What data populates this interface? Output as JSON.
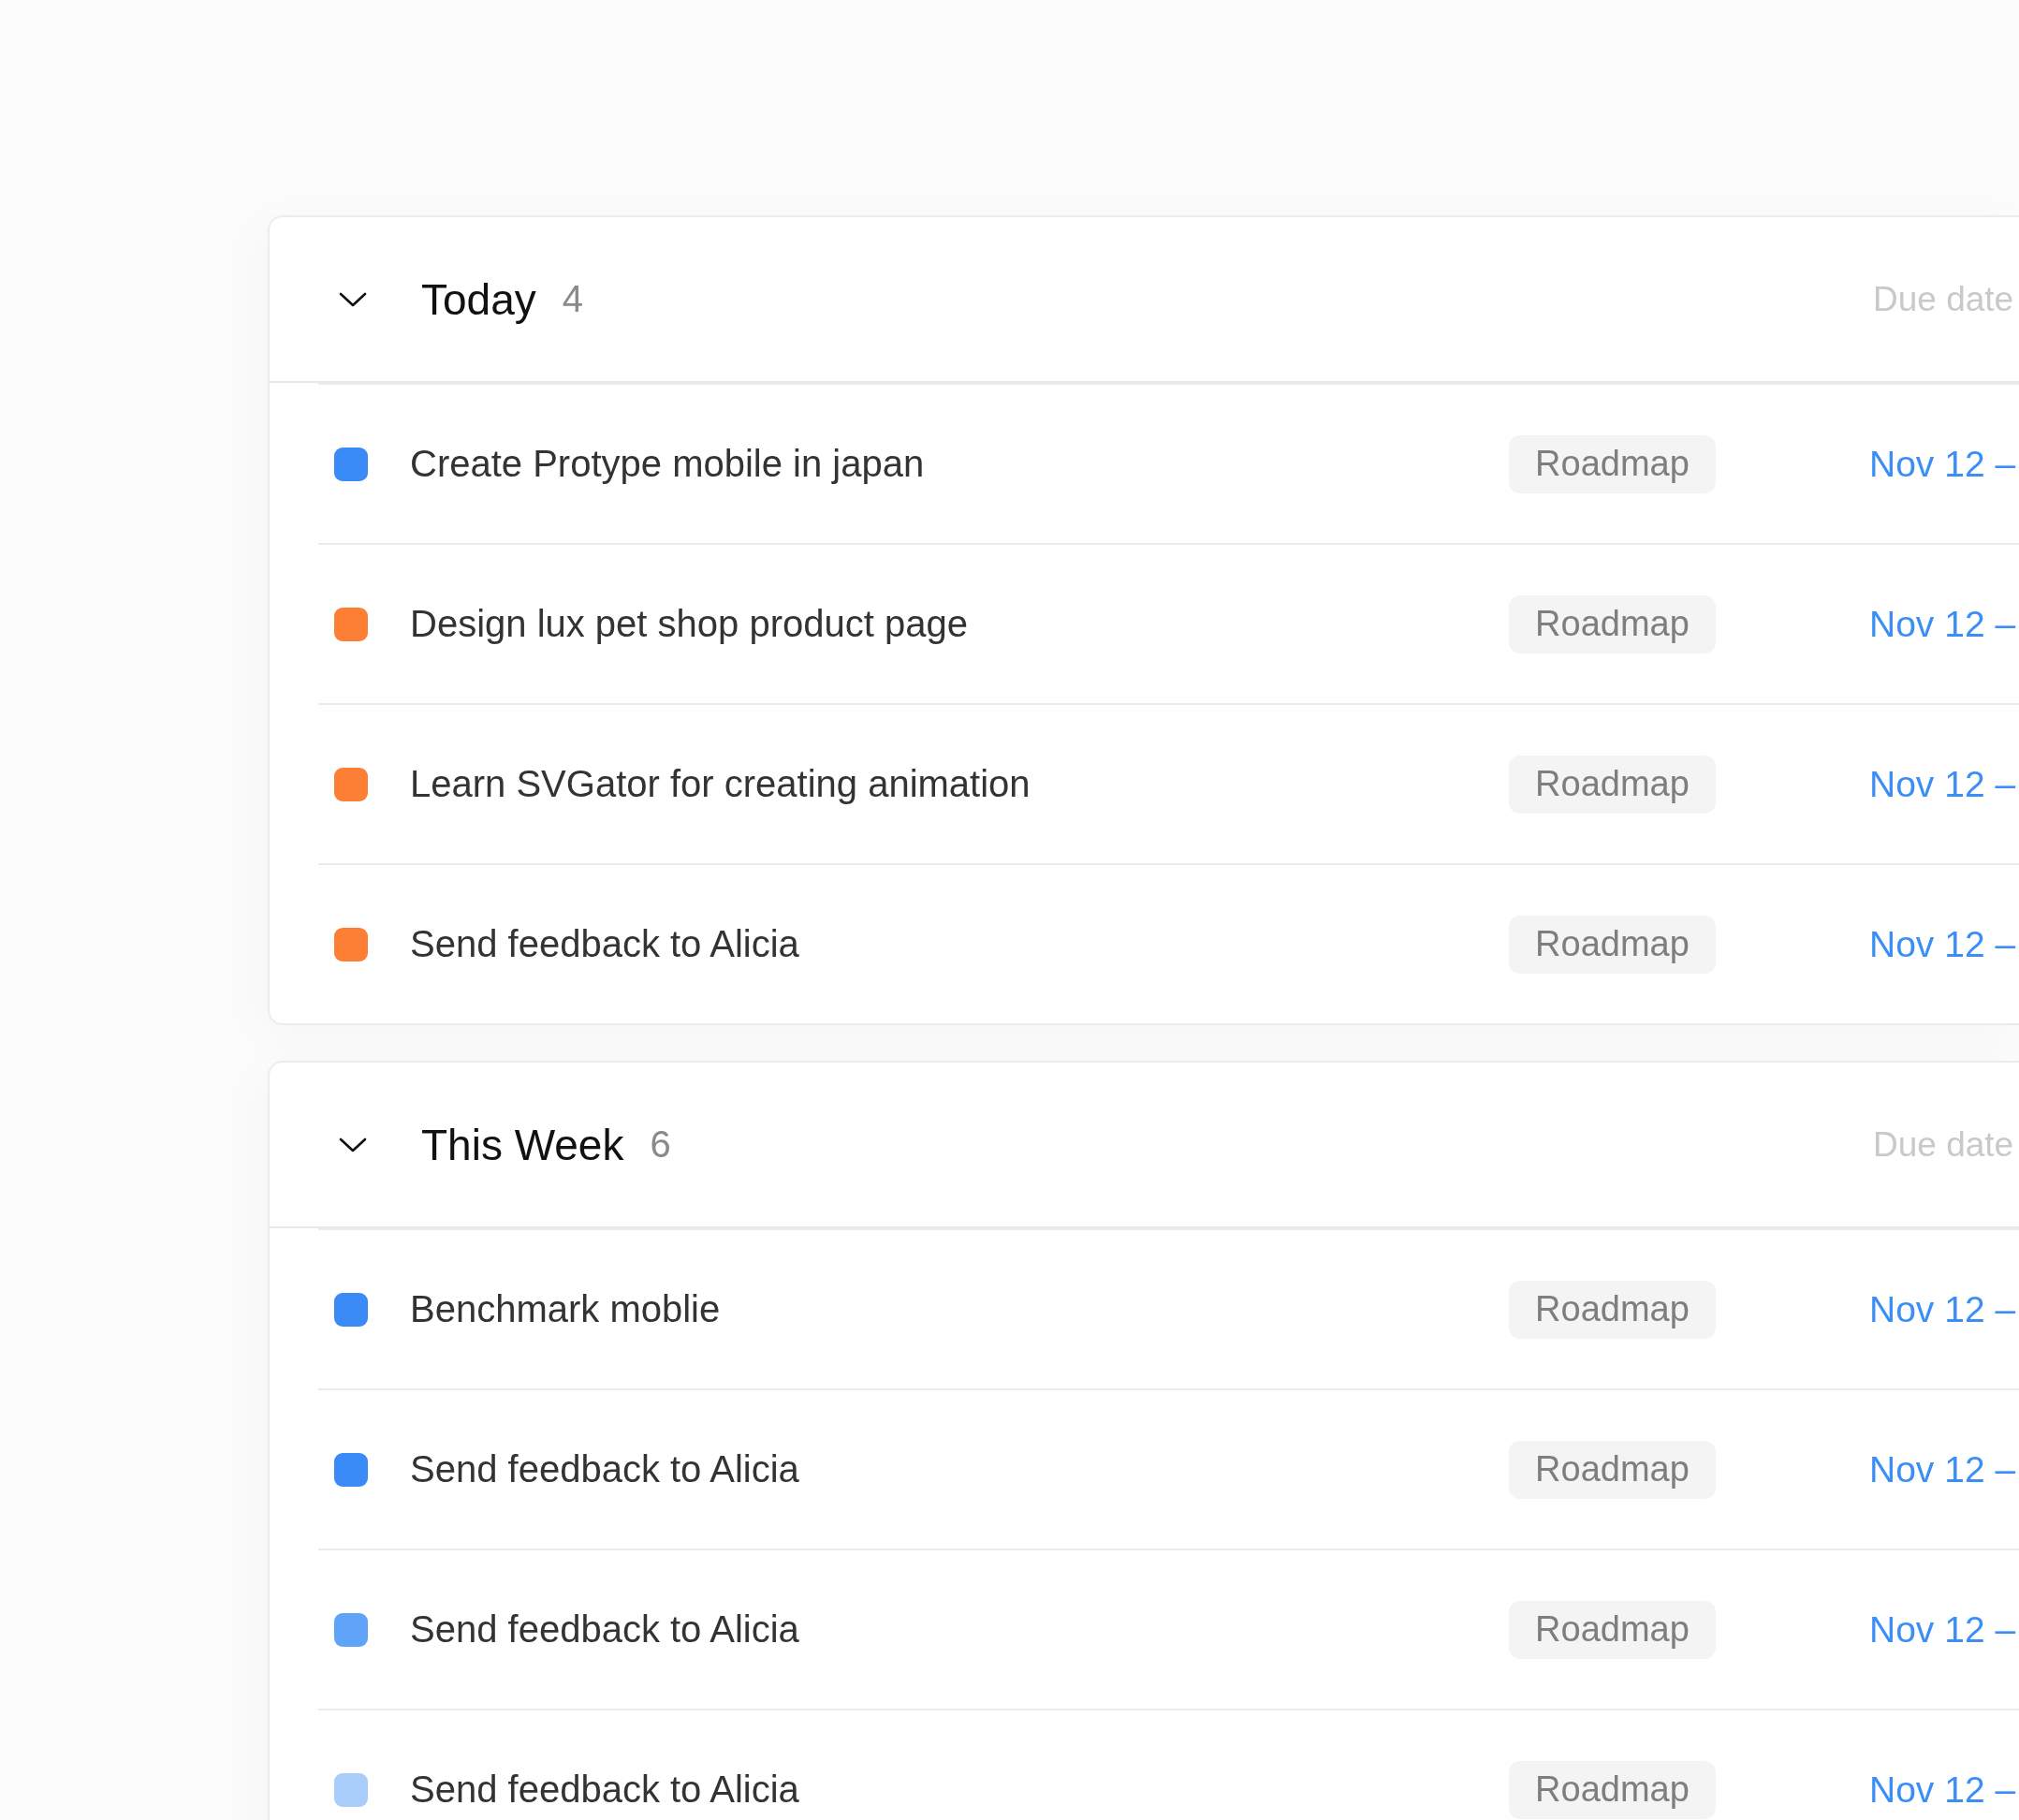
{
  "groups": [
    {
      "title": "Today",
      "count": "4",
      "column_label": "Due date",
      "expanded": true,
      "tasks": [
        {
          "title": "Create Protype mobile in japan",
          "color": "#3a8bf7",
          "tag": "Roadmap",
          "date": "Nov 12 –"
        },
        {
          "title": "Design lux pet shop product page",
          "color": "#fd7e35",
          "tag": "Roadmap",
          "date": "Nov 12 –"
        },
        {
          "title": "Learn SVGator for creating animation",
          "color": "#fd7e35",
          "tag": "Roadmap",
          "date": "Nov 12 –"
        },
        {
          "title": "Send feedback to Alicia",
          "color": "#fd7e35",
          "tag": "Roadmap",
          "date": "Nov 12 –"
        }
      ]
    },
    {
      "title": "This Week",
      "count": "6",
      "column_label": "Due date",
      "expanded": true,
      "tasks": [
        {
          "title": "Benchmark moblie",
          "color": "#3a8bf7",
          "tag": "Roadmap",
          "date": "Nov 12 –"
        },
        {
          "title": "Send feedback to Alicia",
          "color": "#3a8bf7",
          "tag": "Roadmap",
          "date": "Nov 12 –"
        },
        {
          "title": "Send feedback to Alicia",
          "color": "#5fa4f9",
          "tag": "Roadmap",
          "date": "Nov 12 –"
        },
        {
          "title": "Send feedback to Alicia",
          "color": "#a9cdfb",
          "tag": "Roadmap",
          "date": "Nov 12 –"
        }
      ]
    }
  ]
}
